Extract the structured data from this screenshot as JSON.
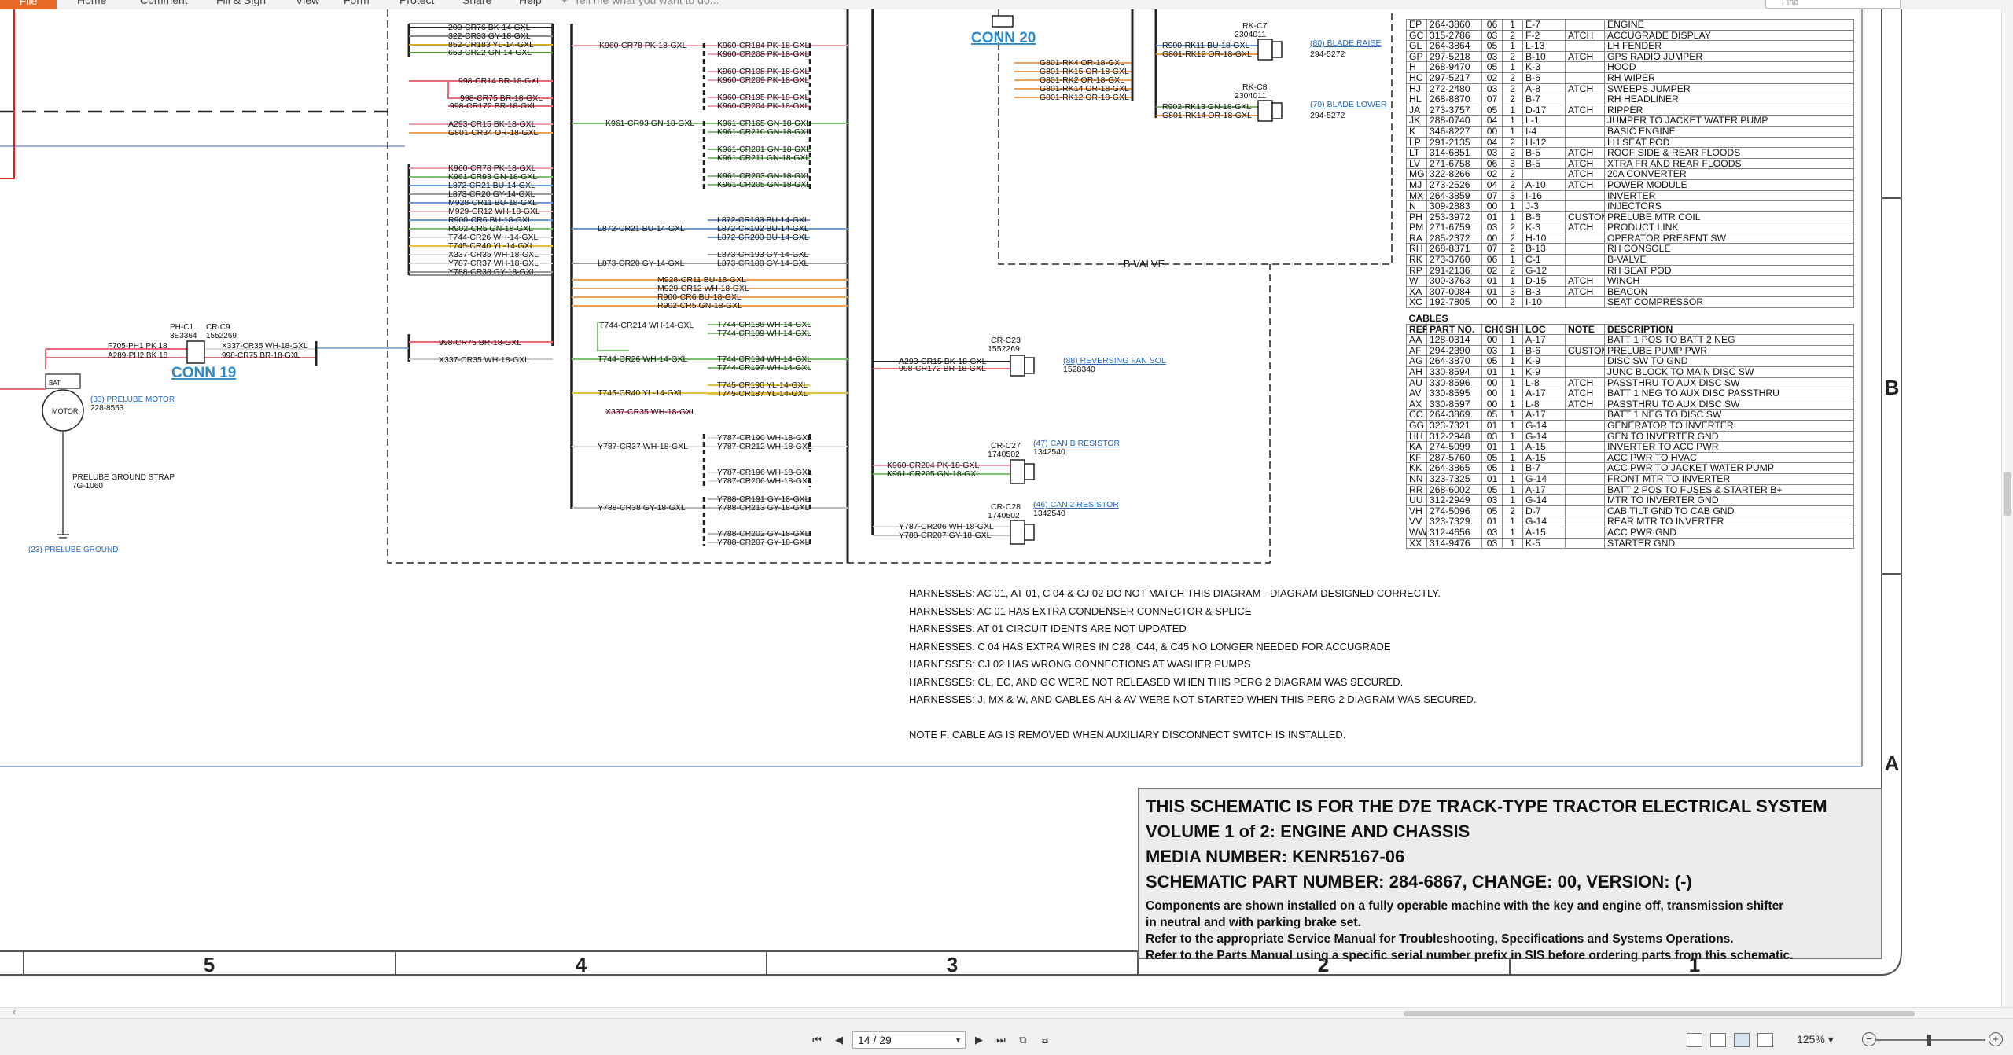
{
  "menu": {
    "file": "File",
    "items": [
      "Home",
      "Comment",
      "Fill & Sign",
      "View",
      "Form",
      "Protect",
      "Share",
      "Help"
    ],
    "tell_me": "Tell me what you want to do...",
    "find_placeholder": "Find"
  },
  "schematic": {
    "conn_labels": [
      "CONN 19",
      "CONN 20"
    ],
    "b_valve": "B VALVE",
    "left_components": {
      "ph_c1": "PH-C1",
      "ph_c1_part": "3E3364",
      "cr_c9": "CR-C9",
      "cr_c9_part": "1552269",
      "motor_ref": "(33) PRELUBE MOTOR",
      "motor_part": "228-8553",
      "motor": "MOTOR",
      "bat": "BAT",
      "strap": "PRELUBE GROUND STRAP",
      "strap_part": "7G-1060",
      "ground": "(23) PRELUBE GROUND",
      "w_f705": "F705-PH1  PK 18",
      "w_a289": "A289-PH2  BK 18",
      "w_x337": "X337-CR35  WH-18-GXL",
      "w_998": "998-CR75  BR-18-GXL",
      "w_998b": "998-CR75  BR-18-GXL",
      "w_x337b": "X337-CR35  WH-18-GXL"
    },
    "col1_wires": [
      "200-CR76  BK-14-GXL",
      "322-CR33  GY-18-GXL",
      "852-CR183  YL-14-GXL",
      "653-CR22  GN-14-GXL",
      "998-CR14  BR-18-GXL",
      "998-CR75  BR-18-GXL",
      "998-CR172  BR-18-GXL",
      "A293-CR15  BK-18-GXL",
      "G801-CR34  OR-18-GXL",
      "K960-CR78  PK-18-GXL",
      "K961-CR93  GN-18-GXL",
      "L872-CR21  BU-14-GXL",
      "L873-CR20  GY-14-GXL",
      "M928-CR11  BU-18-GXL",
      "M929-CR12  WH-18-GXL",
      "R900-CR6  BU-18-GXL",
      "R902-CR5  GN-18-GXL",
      "T744-CR26  WH-14-GXL",
      "T745-CR40  YL-14-GXL",
      "X337-CR35  WH-18-GXL",
      "Y787-CR37  WH-18-GXL",
      "Y788-CR38  GY-18-GXL"
    ],
    "col2_wires": [
      "K960-CR78  PK-18-GXL",
      "K961-CR93  GN-18-GXL",
      "L872-CR21  BU-14-GXL",
      "L873-CR20  GY-14-GXL",
      "T744-CR26  WH-14-GXL",
      "T745-CR40  YL-14-GXL",
      "Y787-CR37  WH-18-GXL",
      "Y788-CR38  GY-18-GXL",
      "M928-CR11  BU-18-GXL",
      "M929-CR12  WH-18-GXL",
      "R900-CR6  BU-18-GXL",
      "R902-CR5  GN-18-GXL",
      "T744-CR214  WH-14-GXL",
      "X337-CR35  WH-18-GXL"
    ],
    "col3_wires": [
      "K960-CR184  PK-18-GXL",
      "K960-CR208  PK-18-GXL",
      "K960-CR108  PK-18-GXL",
      "K960-CR209  PK-18-GXL",
      "K960-CR195  PK-18-GXL",
      "K960-CR204  PK-18-GXL",
      "K961-CR165  GN-18-GXL",
      "K961-CR210  GN-18-GXL",
      "K961-CR201  GN-18-GXL",
      "K961-CR211  GN-18-GXL",
      "K961-CR203  GN-18-GXL",
      "K961-CR205  GN-18-GXL",
      "L872-CR183  BU-14-GXL",
      "L872-CR192  BU-14-GXL",
      "L872-CR200  BU-14-GXL",
      "L873-CR193  GY-14-GXL",
      "L873-CR188  GY-14-GXL",
      "T744-CR186  WH-14-GXL",
      "T744-CR189  WH-14-GXL",
      "T744-CR194  WH-14-GXL",
      "T744-CR197  WH-14-GXL",
      "T745-CR190  YL-14-GXL",
      "T745-CR187  YL-14-GXL",
      "Y787-CR190  WH-18-GXL",
      "Y787-CR212  WH-18-GXL",
      "Y787-CR196  WH-18-GXL",
      "Y787-CR206  WH-18-GXL",
      "Y788-CR191  GY-18-GXL",
      "Y788-CR213  GY-18-GXL",
      "Y788-CR202  GY-18-GXL",
      "Y788-CR207  GY-18-GXL"
    ],
    "right_components": {
      "g801": [
        "G801-RK4  OR-18-GXL",
        "G801-RK15  OR-18-GXL",
        "G801-RK2  OR-18-GXL",
        "G801-RK14  OR-18-GXL",
        "G801-RK12  OR-18-GXL"
      ],
      "rk_c7": "RK-C7",
      "rk_c7_part": "2304011",
      "rk_c8": "RK-C8",
      "rk_c8_part": "2304011",
      "blade_raise": "(80) BLADE RAISE",
      "blade_lower": "(79) BLADE LOWER",
      "blade_part": "294-5272",
      "w_r900": "R900-RK11  BU-18-GXL",
      "w_g801a": "G801-RK12  OR-18-GXL",
      "w_r902": "R902-RK13  GN-18-GXL",
      "w_g801b": "G801-RK14  OR-18-GXL",
      "cr_c23": "CR-C23",
      "cr_c23_part": "1552269",
      "rev_fan": "(88) REVERSING FAN SOL",
      "rev_fan_part": "1528340",
      "w_a293": "A293-CR15  BK-18-GXL",
      "w_998": "998-CR172  BR-18-GXL",
      "cr_c27": "CR-C27",
      "cr_c27_part": "1740502",
      "can_b": "(47) CAN B RESISTOR",
      "can_b_part": "1342540",
      "w_k960": "K960-CR204  PK-18-GXL",
      "w_k961": "K961-CR205  GN-18-GXL",
      "cr_c28": "CR-C28",
      "cr_c28_part": "1740502",
      "can_2": "(46) CAN 2 RESISTOR",
      "can_2_part": "1342540",
      "w_y787": "Y787-CR206  WH-18-GXL",
      "w_y788": "Y788-CR207  GY-18-GXL"
    }
  },
  "harnesses_table": {
    "rows": [
      [
        "EP",
        "264-3860",
        "06",
        "1",
        "E-7",
        "",
        "ENGINE"
      ],
      [
        "GC",
        "315-2786",
        "03",
        "2",
        "F-2",
        "ATCH",
        "ACCUGRADE DISPLAY"
      ],
      [
        "GL",
        "264-3864",
        "05",
        "1",
        "L-13",
        "",
        "LH FENDER"
      ],
      [
        "GP",
        "297-5218",
        "03",
        "2",
        "B-10",
        "ATCH",
        "GPS RADIO JUMPER"
      ],
      [
        "H",
        "268-9470",
        "05",
        "1",
        "K-3",
        "",
        "HOOD"
      ],
      [
        "HC",
        "297-5217",
        "02",
        "2",
        "B-6",
        "",
        "RH WIPER"
      ],
      [
        "HJ",
        "272-2480",
        "03",
        "2",
        "A-8",
        "ATCH",
        "SWEEPS JUMPER"
      ],
      [
        "HL",
        "268-8870",
        "07",
        "2",
        "B-7",
        "",
        "RH HEADLINER"
      ],
      [
        "JA",
        "273-3757",
        "05",
        "1",
        "D-17",
        "ATCH",
        "RIPPER"
      ],
      [
        "JK",
        "288-0740",
        "04",
        "1",
        "L-1",
        "",
        "JUMPER TO JACKET WATER PUMP"
      ],
      [
        "K",
        "346-8227",
        "00",
        "1",
        "I-4",
        "",
        "BASIC ENGINE"
      ],
      [
        "LP",
        "291-2135",
        "04",
        "2",
        "H-12",
        "",
        "LH SEAT POD"
      ],
      [
        "LT",
        "314-6851",
        "03",
        "2",
        "B-5",
        "ATCH",
        "ROOF SIDE & REAR FLOODS"
      ],
      [
        "LV",
        "271-6758",
        "06",
        "3",
        "B-5",
        "ATCH",
        "XTRA FR AND REAR FLOODS"
      ],
      [
        "MG",
        "322-8266",
        "02",
        "2",
        "",
        "ATCH",
        "20A CONVERTER"
      ],
      [
        "MJ",
        "273-2526",
        "04",
        "2",
        "A-10",
        "ATCH",
        "POWER MODULE"
      ],
      [
        "MX",
        "264-3859",
        "07",
        "3",
        "I-16",
        "",
        "INVERTER"
      ],
      [
        "N",
        "309-2883",
        "00",
        "1",
        "J-3",
        "",
        "INJECTORS"
      ],
      [
        "PH",
        "253-3972",
        "01",
        "1",
        "B-6",
        "CUSTOM",
        "PRELUBE MTR COIL"
      ],
      [
        "PM",
        "271-6759",
        "03",
        "2",
        "K-3",
        "ATCH",
        "PRODUCT LINK"
      ],
      [
        "RA",
        "285-2372",
        "00",
        "2",
        "H-10",
        "",
        "OPERATOR PRESENT SW"
      ],
      [
        "RH",
        "268-8871",
        "07",
        "2",
        "B-13",
        "",
        "RH CONSOLE"
      ],
      [
        "RK",
        "273-3760",
        "06",
        "1",
        "C-1",
        "",
        "B-VALVE"
      ],
      [
        "RP",
        "291-2136",
        "02",
        "2",
        "G-12",
        "",
        "RH SEAT POD"
      ],
      [
        "W",
        "300-3763",
        "01",
        "1",
        "D-15",
        "ATCH",
        "WINCH"
      ],
      [
        "XA",
        "307-0084",
        "01",
        "3",
        "B-3",
        "ATCH",
        "BEACON"
      ],
      [
        "XC",
        "192-7805",
        "00",
        "2",
        "I-10",
        "",
        "SEAT COMPRESSOR"
      ]
    ]
  },
  "cables_table": {
    "caption": "CABLES",
    "headers": [
      "REF",
      "PART NO.",
      "CHG",
      "SH",
      "LOC",
      "NOTE",
      "DESCRIPTION"
    ],
    "rows": [
      [
        "AA",
        "128-0314",
        "00",
        "1",
        "A-17",
        "",
        "BATT 1 POS TO BATT 2 NEG"
      ],
      [
        "AF",
        "294-2390",
        "03",
        "1",
        "B-6",
        "CUSTOM",
        "PRELUBE PUMP PWR"
      ],
      [
        "AG",
        "264-3870",
        "05",
        "1",
        "K-9",
        "",
        "DISC SW TO GND"
      ],
      [
        "AH",
        "330-8594",
        "01",
        "1",
        "K-9",
        "",
        "JUNC BLOCK TO MAIN DISC SW"
      ],
      [
        "AU",
        "330-8596",
        "00",
        "1",
        "L-8",
        "ATCH",
        "PASSTHRU TO AUX DISC SW"
      ],
      [
        "AV",
        "330-8595",
        "00",
        "1",
        "A-17",
        "ATCH",
        "BATT 1 NEG TO AUX DISC PASSTHRU"
      ],
      [
        "AX",
        "330-8597",
        "00",
        "1",
        "L-8",
        "ATCH",
        "PASSTHRU TO AUX DISC SW"
      ],
      [
        "CC",
        "264-3869",
        "05",
        "1",
        "A-17",
        "",
        "BATT 1 NEG TO DISC SW"
      ],
      [
        "GG",
        "323-7321",
        "01",
        "1",
        "G-14",
        "",
        "GENERATOR TO INVERTER"
      ],
      [
        "HH",
        "312-2948",
        "03",
        "1",
        "G-14",
        "",
        "GEN TO INVERTER GND"
      ],
      [
        "KA",
        "274-5099",
        "01",
        "1",
        "A-15",
        "",
        "INVERTER TO ACC PWR"
      ],
      [
        "KF",
        "287-5760",
        "05",
        "1",
        "A-15",
        "",
        "ACC PWR TO HVAC"
      ],
      [
        "KK",
        "264-3865",
        "05",
        "1",
        "B-7",
        "",
        "ACC PWR TO JACKET WATER PUMP"
      ],
      [
        "NN",
        "323-7325",
        "01",
        "1",
        "G-14",
        "",
        "FRONT MTR TO INVERTER"
      ],
      [
        "RR",
        "268-6002",
        "05",
        "1",
        "A-17",
        "",
        "BATT 2 POS TO FUSES & STARTER B+"
      ],
      [
        "UU",
        "312-2949",
        "03",
        "1",
        "G-14",
        "",
        "MTR TO INVERTER GND"
      ],
      [
        "VH",
        "274-5096",
        "05",
        "2",
        "D-7",
        "",
        "CAB TILT GND TO CAB GND"
      ],
      [
        "VV",
        "323-7329",
        "01",
        "1",
        "G-14",
        "",
        "REAR MTR TO INVERTER"
      ],
      [
        "WW",
        "312-4656",
        "03",
        "1",
        "A-15",
        "",
        "ACC PWR GND"
      ],
      [
        "XX",
        "314-9476",
        "03",
        "1",
        "K-5",
        "",
        "STARTER GND"
      ]
    ]
  },
  "harness_notes": [
    "HARNESSES: AC 01, AT 01, C 04 & CJ 02 DO NOT MATCH THIS DIAGRAM - DIAGRAM DESIGNED CORRECTLY.",
    "HARNESSES: AC 01 HAS EXTRA CONDENSER CONNECTOR & SPLICE",
    "HARNESSES: AT 01 CIRCUIT IDENTS ARE NOT UPDATED",
    "HARNESSES: C 04 HAS EXTRA WIRES IN C28, C44, & C45 NO LONGER NEEDED FOR ACCUGRADE",
    "HARNESSES: CJ 02 HAS WRONG CONNECTIONS AT WASHER PUMPS",
    "HARNESSES: CL, EC, AND GC WERE NOT RELEASED WHEN THIS PERG 2 DIAGRAM WAS SECURED.",
    "HARNESSES: J, MX & W, AND CABLES AH & AV WERE NOT STARTED WHEN THIS PERG 2 DIAGRAM WAS SECURED."
  ],
  "note_f": "NOTE F: CABLE AG IS REMOVED WHEN AUXILIARY DISCONNECT SWITCH IS INSTALLED.",
  "title_block": {
    "line1": "THIS SCHEMATIC IS FOR THE D7E TRACK-TYPE TRACTOR ELECTRICAL SYSTEM",
    "line2": "VOLUME 1 of 2: ENGINE AND CHASSIS",
    "line3": "MEDIA NUMBER: KENR5167-06",
    "line4": "SCHEMATIC PART NUMBER: 284-6867, CHANGE: 00, VERSION: (-)",
    "info": [
      "Components are shown installed on a fully operable machine with the key and engine off, transmission shifter",
      "in neutral and with parking brake set.",
      "Refer to the appropriate Service Manual for Troubleshooting, Specifications and Systems Operations.",
      "Refer to the Parts Manual using a specific serial number prefix in SIS before ordering parts from this schematic."
    ]
  },
  "grid": {
    "columns": [
      "5",
      "4",
      "3",
      "2",
      "1"
    ],
    "rows": [
      "B",
      "A"
    ]
  },
  "status": {
    "page": "14 / 29",
    "zoom": "125%"
  }
}
